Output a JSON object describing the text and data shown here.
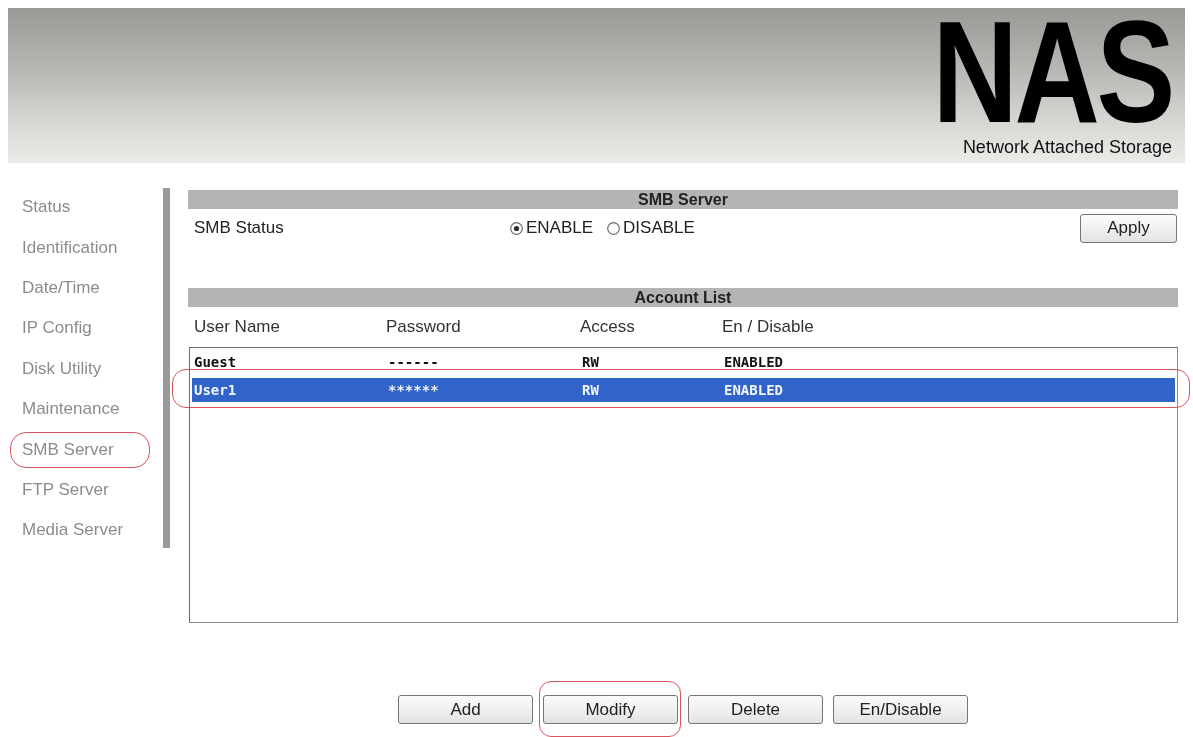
{
  "header": {
    "logo": "NAS",
    "subtitle": "Network Attached Storage"
  },
  "sidebar": {
    "items": [
      {
        "label": "Status",
        "highlighted": false
      },
      {
        "label": "Identification",
        "highlighted": false
      },
      {
        "label": "Date/Time",
        "highlighted": false
      },
      {
        "label": "IP Config",
        "highlighted": false
      },
      {
        "label": "Disk Utility",
        "highlighted": false
      },
      {
        "label": "Maintenance",
        "highlighted": false
      },
      {
        "label": "SMB Server",
        "highlighted": true
      },
      {
        "label": "FTP Server",
        "highlighted": false
      },
      {
        "label": "Media Server",
        "highlighted": false
      }
    ]
  },
  "smb_server": {
    "title": "SMB Server",
    "status_label": "SMB Status",
    "options": [
      {
        "label": "ENABLE",
        "selected": true
      },
      {
        "label": "DISABLE",
        "selected": false
      }
    ],
    "apply_button": "Apply"
  },
  "account_list": {
    "title": "Account List",
    "columns": [
      "User Name",
      "Password",
      "Access",
      "En / Disable"
    ],
    "rows": [
      {
        "cells": [
          "Guest",
          "------",
          "RW",
          "ENABLED"
        ],
        "selected": false,
        "highlighted": false
      },
      {
        "cells": [
          "User1",
          "******",
          "RW",
          "ENABLED"
        ],
        "selected": true,
        "highlighted": true
      }
    ]
  },
  "buttons": [
    {
      "label": "Add",
      "highlighted": false
    },
    {
      "label": "Modify",
      "highlighted": true
    },
    {
      "label": "Delete",
      "highlighted": false
    },
    {
      "label": "En/Disable",
      "highlighted": false
    }
  ]
}
